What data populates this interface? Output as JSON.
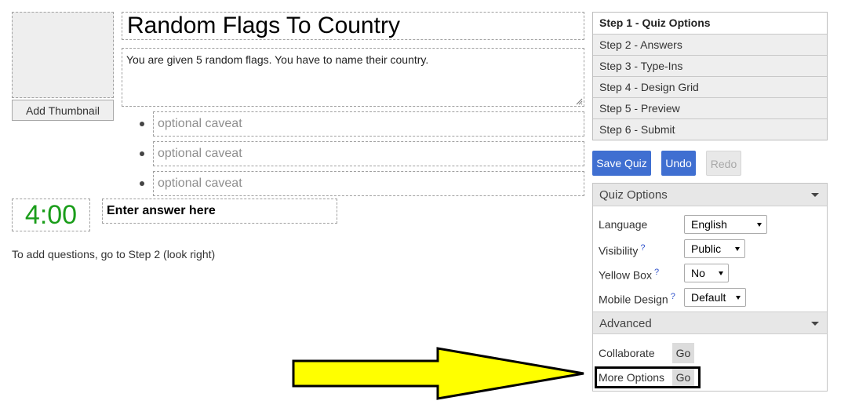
{
  "editor": {
    "thumbnail_button": "Add Thumbnail",
    "title": "Random Flags To Country",
    "description": "You are given 5 random flags. You have to name their country.",
    "caveat_placeholders": [
      "optional caveat",
      "optional caveat",
      "optional caveat"
    ],
    "timer": "4:00",
    "answer_placeholder": "Enter answer here",
    "hint": "To add questions, go to Step 2 (look right)"
  },
  "steps": [
    {
      "label": "Step 1 - Quiz Options"
    },
    {
      "label": "Step 2 - Answers"
    },
    {
      "label": "Step 3 - Type-Ins"
    },
    {
      "label": "Step 4 - Design Grid"
    },
    {
      "label": "Step 5 - Preview"
    },
    {
      "label": "Step 6 - Submit"
    }
  ],
  "actions": {
    "save": "Save Quiz",
    "undo": "Undo",
    "redo": "Redo"
  },
  "quiz_options": {
    "header": "Quiz Options",
    "language": {
      "label": "Language",
      "value": "English"
    },
    "visibility": {
      "label": "Visibility",
      "help": "?",
      "value": "Public"
    },
    "yellow_box": {
      "label": "Yellow Box",
      "help": "?",
      "value": "No"
    },
    "mobile_design": {
      "label": "Mobile Design",
      "help": "?",
      "value": "Default"
    }
  },
  "advanced": {
    "header": "Advanced",
    "collaborate": {
      "label": "Collaborate",
      "button": "Go"
    },
    "more_options": {
      "label": "More Options",
      "button": "Go"
    }
  },
  "colors": {
    "primary_button": "#3f6fd1",
    "timer": "#1a9d1a",
    "arrow_fill": "#ffff00"
  },
  "icons": [
    "dropdown-caret-icon",
    "help-icon",
    "arrow-pointer-icon",
    "resize-handle-icon"
  ]
}
